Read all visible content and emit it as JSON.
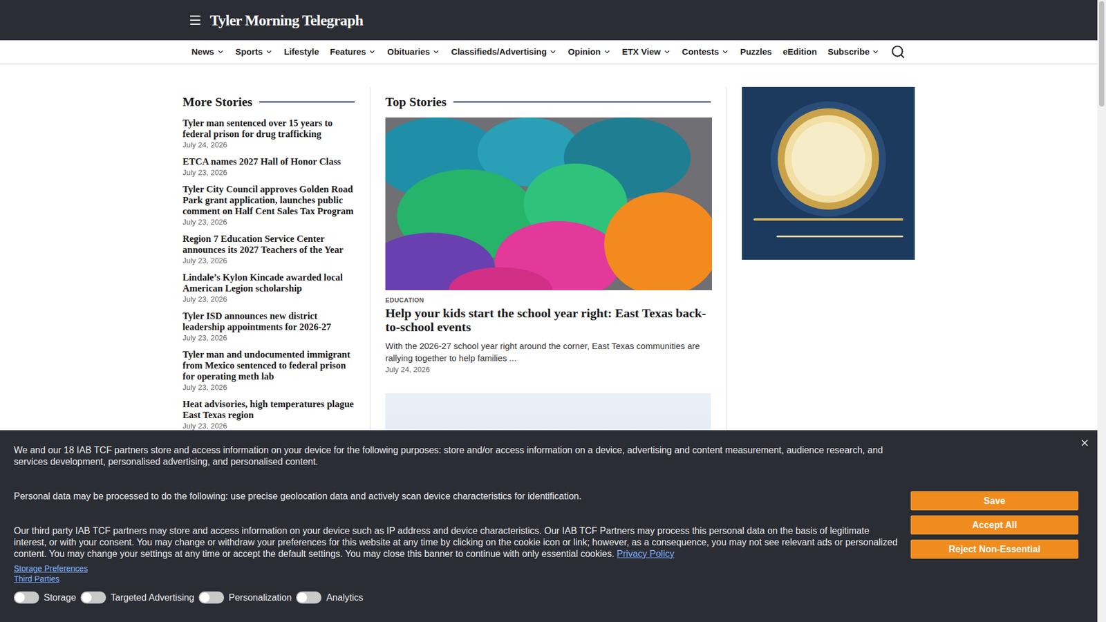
{
  "header": {
    "logo": "Tyler Morning Telegraph"
  },
  "nav": [
    {
      "label": "News",
      "menu": true
    },
    {
      "label": "Sports",
      "menu": true
    },
    {
      "label": "Lifestyle",
      "menu": false
    },
    {
      "label": "Features",
      "menu": true
    },
    {
      "label": "Obituaries",
      "menu": true
    },
    {
      "label": "Classifieds/Advertising",
      "menu": true
    },
    {
      "label": "Opinion",
      "menu": true
    },
    {
      "label": "ETX View",
      "menu": true
    },
    {
      "label": "Contests",
      "menu": true
    },
    {
      "label": "Puzzles",
      "menu": false
    },
    {
      "label": "eEdition",
      "menu": false
    },
    {
      "label": "Subscribe",
      "menu": true
    }
  ],
  "more_stories": {
    "title": "More Stories",
    "items": [
      {
        "title": "Tyler man sentenced over 15 years to federal prison for drug trafficking",
        "date": "July 24, 2026"
      },
      {
        "title": "ETCA names 2027 Hall of Honor Class",
        "date": "July 23, 2026"
      },
      {
        "title": "Tyler City Council approves Golden Road Park grant application, launches public comment on Half Cent Sales Tax Program",
        "date": "July 23, 2026"
      },
      {
        "title": "Region 7 Education Service Center announces its 2027 Teachers of the Year",
        "date": "July 23, 2026"
      },
      {
        "title": "Lindale’s Kylon Kincade awarded local American Legion scholarship",
        "date": "July 23, 2026"
      },
      {
        "title": "Tyler ISD announces new district leadership appointments for 2026-27",
        "date": "July 23, 2026"
      },
      {
        "title": "Tyler man and undocumented immigrant from Mexico sentenced to federal prison for operating meth lab",
        "date": "July 23, 2026"
      },
      {
        "title": "Heat advisories, high temperatures plague East Texas region",
        "date": "July 23, 2026"
      }
    ]
  },
  "top_stories": {
    "title": "Top Stories",
    "featured": {
      "category": "EDUCATION",
      "title": "Help your kids start the school year right: East Texas back-to-school events",
      "excerpt": "With the 2026-27 school year right around the corner, East Texas communities are rallying together to help families ...",
      "date": "July 24, 2026"
    }
  },
  "cookie_banner": {
    "paragraphs": [
      "We and our 18 IAB TCF partners store and access information on your device for the following purposes: store and/or access information on a device, advertising and content measurement, audience research, and services development, personalised advertising, and personalised content.",
      "Personal data may be processed to do the following: use precise geolocation data and actively scan device characteristics for identification.",
      "Our third party IAB TCF partners may store and access information on your device such as IP address and device characteristics. Our IAB TCF Partners may process this personal data on the basis of legitimate interest, or with your consent. You may change or withdraw your preferences for this website at any time by clicking on the cookie icon or link; however, as a consequence, you may not see relevant ads or personalized content. You may change your settings at any time or accept the default settings. You may close this banner to continue with only essential cookies."
    ],
    "privacy_link": "Privacy Policy",
    "links": [
      "Storage Preferences",
      "Third Parties"
    ],
    "toggles": [
      {
        "label": "Storage",
        "on": false
      },
      {
        "label": "Targeted Advertising",
        "on": false
      },
      {
        "label": "Personalization",
        "on": false
      },
      {
        "label": "Analytics",
        "on": false
      }
    ],
    "buttons": [
      "Save",
      "Accept All",
      "Reject Non-Essential"
    ]
  }
}
